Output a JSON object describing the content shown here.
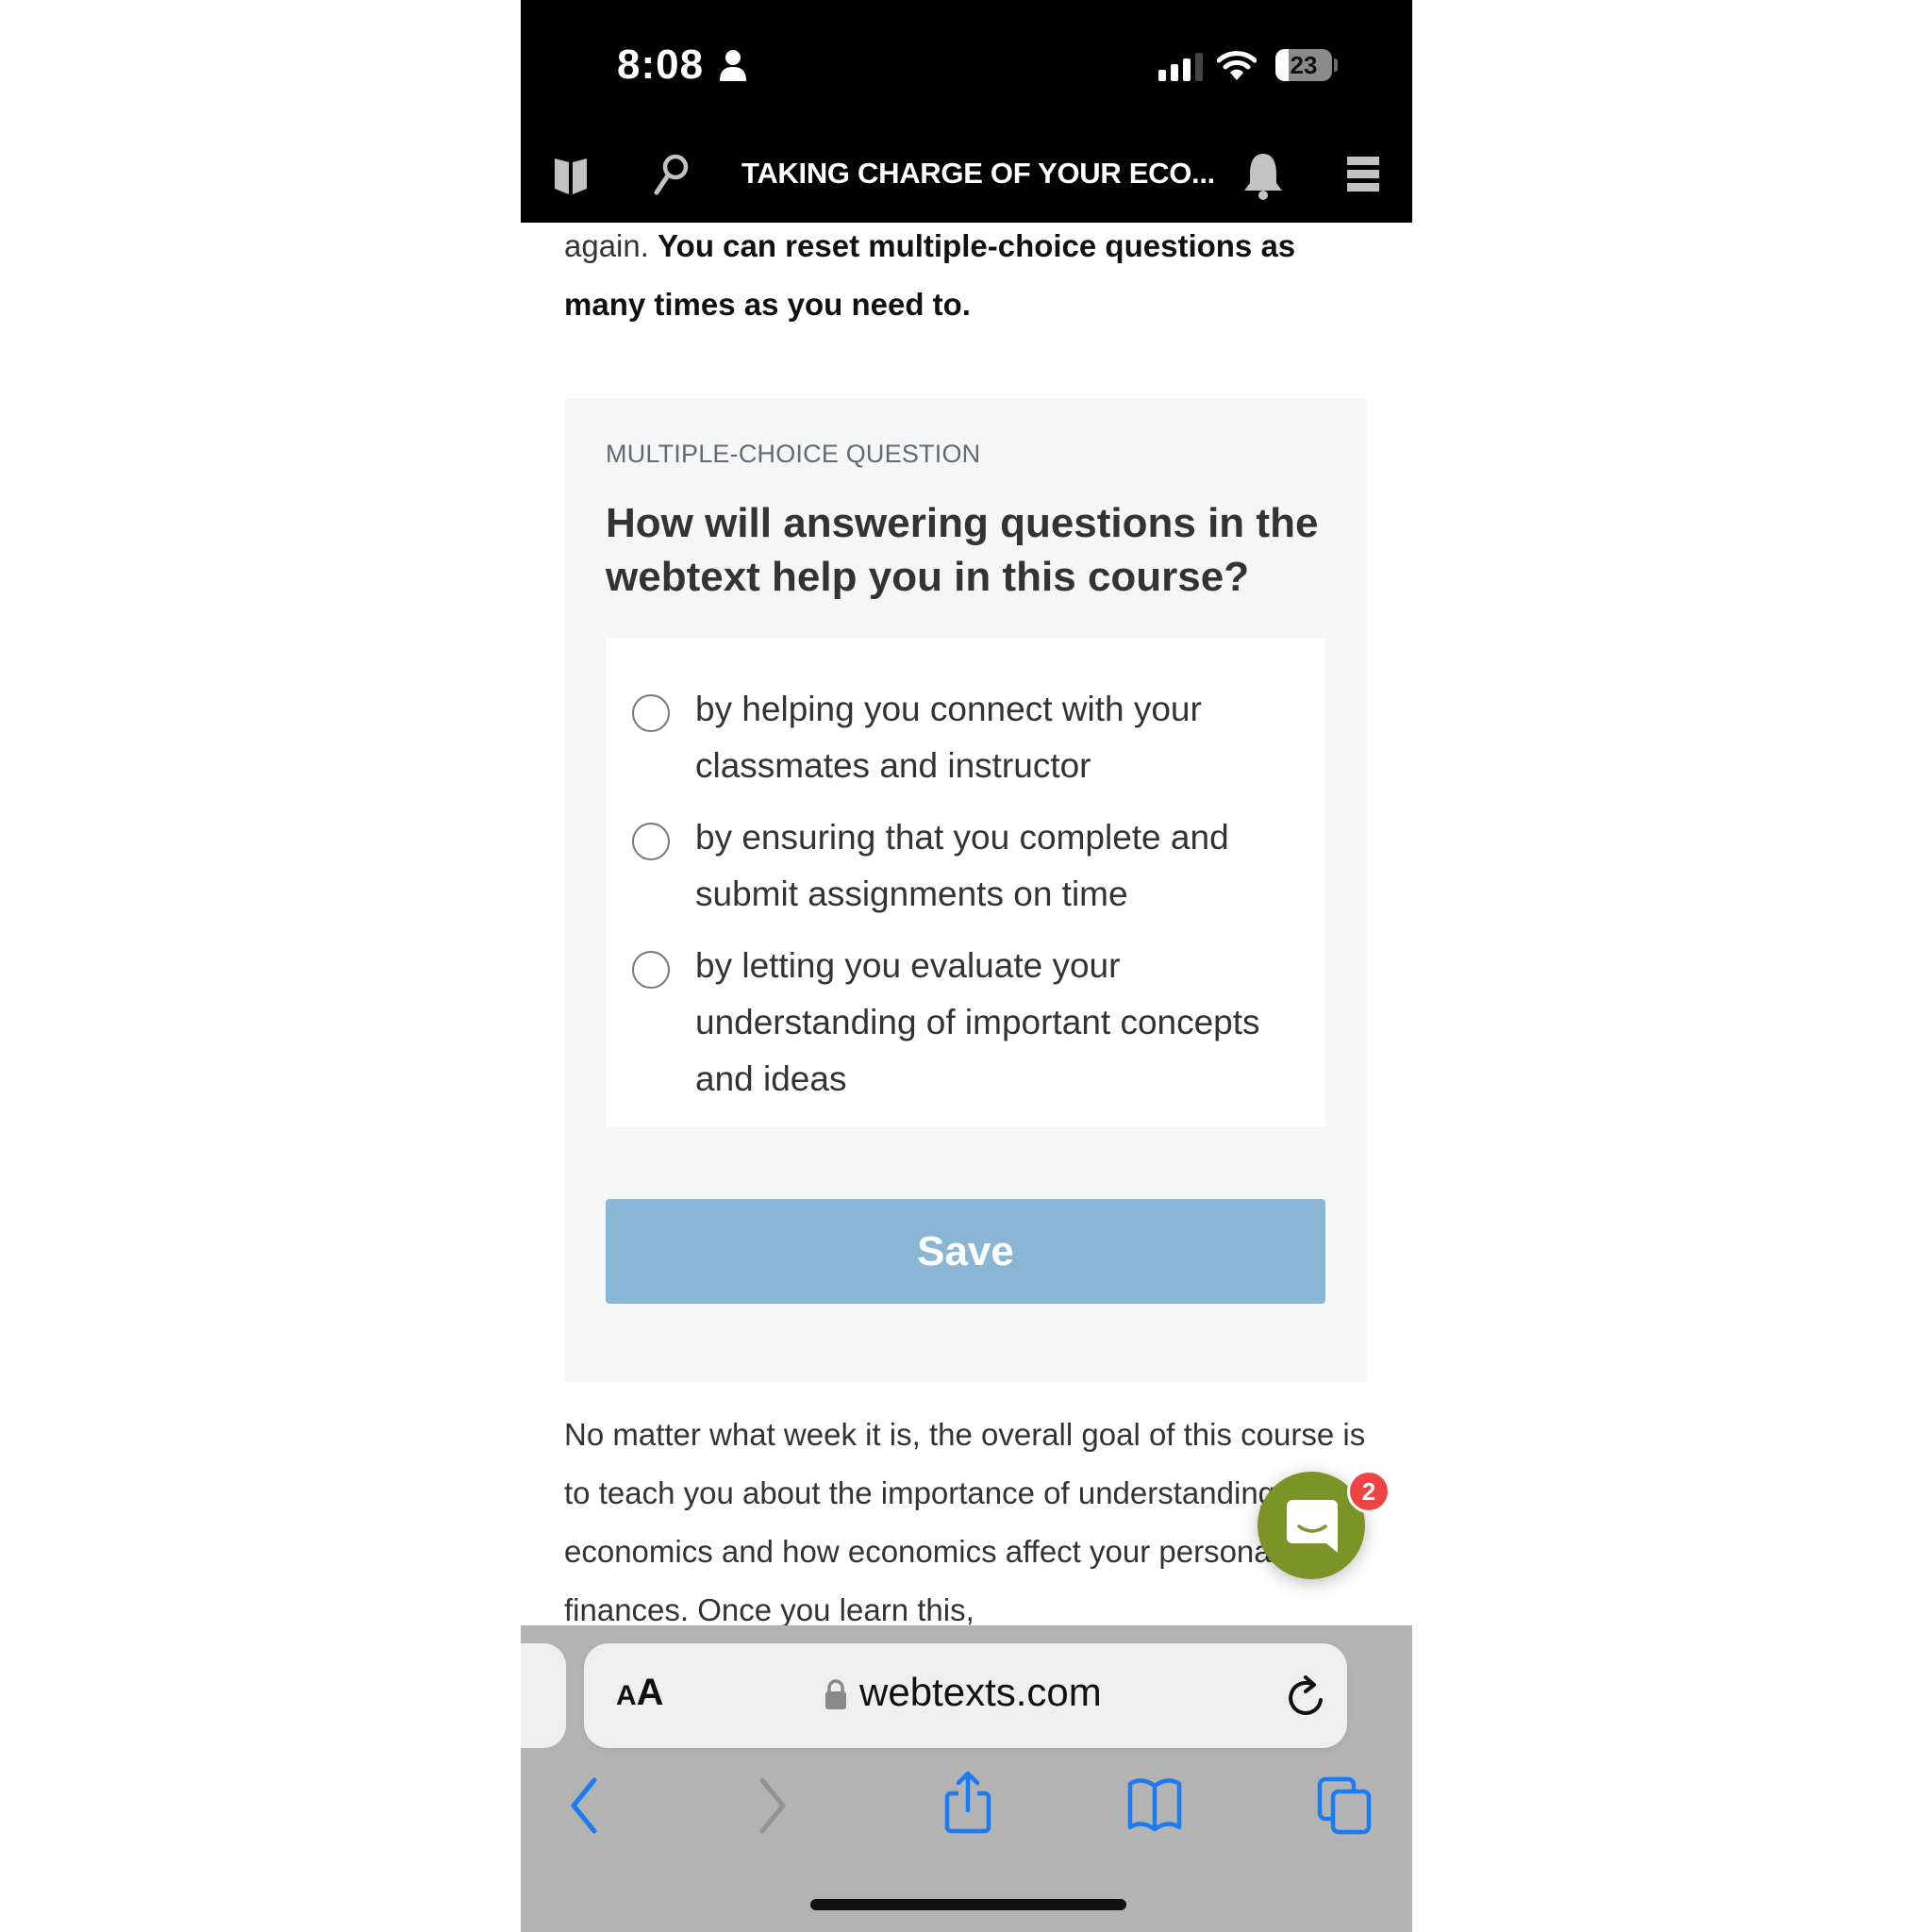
{
  "status_bar": {
    "time": "8:08",
    "battery_percent": "23",
    "battery_level": 0.23
  },
  "app_header": {
    "title": "TAKING CHARGE OF YOUR ECO...",
    "icons": [
      "book-icon",
      "search-icon",
      "bell-icon",
      "menu-icon"
    ]
  },
  "intro": {
    "normal": "again. ",
    "bold": "You can reset multiple-choice questions as many times as you need to."
  },
  "question": {
    "label": "MULTIPLE-CHOICE QUESTION",
    "text": "How will answering questions in the webtext help you in this course?",
    "options": [
      {
        "text": "by helping you connect with your classmates and instructor",
        "selected": false
      },
      {
        "text": "by ensuring that you complete and submit assignments on time",
        "selected": false
      },
      {
        "text": "by letting you evaluate your understanding of important concepts and ideas",
        "selected": false
      }
    ],
    "save_label": "Save"
  },
  "body_paragraph": "No matter what week it is, the overall goal of this course is to teach you about the importance of understanding economics and how economics affect your personal finances. Once you learn this,",
  "chat": {
    "badge_count": "2",
    "accent": "#7b9327"
  },
  "safari": {
    "aa_small": "A",
    "aa_large": "A",
    "url": "webtexts.com",
    "toolbar": [
      "back-icon",
      "forward-icon",
      "share-icon",
      "bookmarks-icon",
      "tabs-icon"
    ],
    "accent": "#1a7cf5"
  },
  "colors": {
    "save_button": "#8ab6d6",
    "card_bg": "#f6f6f6",
    "label": "#5d6b7a"
  }
}
